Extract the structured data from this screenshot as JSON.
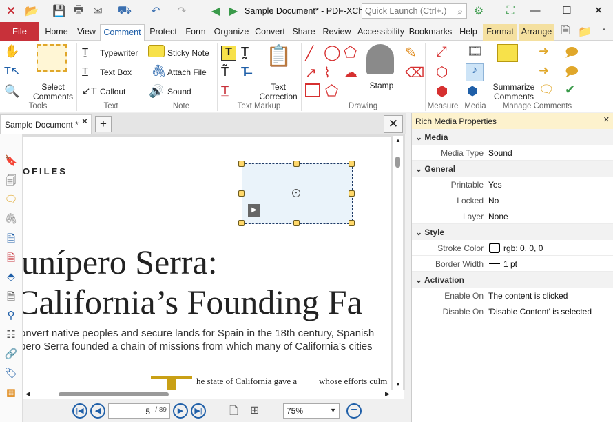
{
  "titlebar": {
    "doc_title": "Sample Document* - PDF-XCh..",
    "quick_launch_placeholder": "Quick Launch (Ctrl+.)",
    "minimize": "—",
    "maximize": "☐",
    "close": "✕"
  },
  "menu_tabs": [
    "File",
    "Home",
    "View",
    "Comment",
    "Protect",
    "Form",
    "Organize",
    "Convert",
    "Share",
    "Review",
    "Accessibility",
    "Bookmarks",
    "Help",
    "Format",
    "Arrange"
  ],
  "ribbon": {
    "groups": [
      "Tools",
      "Text",
      "Note",
      "Text Markup",
      "Drawing",
      "Measure",
      "Media",
      "Manage Comments"
    ],
    "select_comments": [
      "Select",
      "Comments"
    ],
    "typewriter": "Typewriter",
    "text_box": "Text Box",
    "callout": "Callout",
    "sticky_note": "Sticky Note",
    "attach_file": "Attach File",
    "sound": "Sound",
    "text_correction": [
      "Text",
      "Correction"
    ],
    "stamp": "Stamp",
    "summarize_comments": [
      "Summarize",
      "Comments"
    ]
  },
  "document": {
    "tab_label": "Sample Document *",
    "header_fragment": "OFILES",
    "heading_line1": "unípero Serra:",
    "heading_line2": "California’s Founding Fa",
    "body_line1": "onvert native peoples and secure lands for Spain in the 18th century, Spanish",
    "body_line2": "pero Serra founded a chain of missions from which many of California’s cities",
    "col_text_left": "he state of California gave a",
    "col_text_right": "whose efforts culm"
  },
  "statusbar": {
    "page_current": "5",
    "page_total": "/ 89",
    "zoom": "75%"
  },
  "panel": {
    "title": "Rich Media Properties",
    "sections": {
      "media": "Media",
      "general": "General",
      "style": "Style",
      "activation": "Activation"
    },
    "media_type_label": "Media Type",
    "media_type_value": "Sound",
    "printable_label": "Printable",
    "printable_value": "Yes",
    "locked_label": "Locked",
    "locked_value": "No",
    "layer_label": "Layer",
    "layer_value": "None",
    "stroke_color_label": "Stroke Color",
    "stroke_color_value": "rgb: 0, 0, 0",
    "border_width_label": "Border Width",
    "border_width_value": "1 pt",
    "enable_on_label": "Enable On",
    "enable_on_value": "The content is clicked",
    "disable_on_label": "Disable On",
    "disable_on_value": "'Disable Content' is selected"
  },
  "colors": {
    "accent": "#c8313a",
    "selection": "#1f5fa8",
    "annotation_fill": "#eaf3fa",
    "panel_header": "#fdf2cd"
  }
}
